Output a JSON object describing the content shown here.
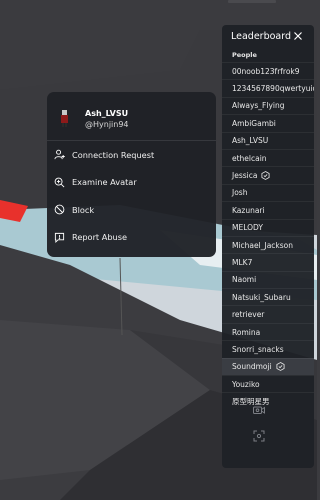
{
  "leaderboard": {
    "title": "Leaderboard",
    "section_label": "People",
    "players": [
      {
        "name": "00noob123frfrok9",
        "verified": false
      },
      {
        "name": "1234567890qwertyuiop",
        "verified": false
      },
      {
        "name": "Always_Flying",
        "verified": false
      },
      {
        "name": "AmbiGambi",
        "verified": false
      },
      {
        "name": "Ash_LVSU",
        "verified": false
      },
      {
        "name": "ethelcain",
        "verified": false
      },
      {
        "name": "Jessica",
        "verified": true
      },
      {
        "name": "Josh",
        "verified": false
      },
      {
        "name": "Kazunari",
        "verified": false
      },
      {
        "name": "MELODY",
        "verified": false
      },
      {
        "name": "Michael_Jackson",
        "verified": false
      },
      {
        "name": "MLK7",
        "verified": false
      },
      {
        "name": "Naomi",
        "verified": false
      },
      {
        "name": "Natsuki_Subaru",
        "verified": false
      },
      {
        "name": "retriever",
        "verified": false
      },
      {
        "name": "Romina",
        "verified": false
      },
      {
        "name": "Snorri_snacks",
        "verified": false
      },
      {
        "name": "Soundmoji",
        "verified": true,
        "highlighted": true
      },
      {
        "name": "Youziko",
        "verified": false
      },
      {
        "name": "原型明星男",
        "verified": false
      }
    ],
    "icons": [
      "close-icon",
      "verified-badge-icon",
      "voice-chat-icon",
      "fullscreen-icon"
    ]
  },
  "popup": {
    "display_name": "Ash_LVSU",
    "username": "@Hynjin94",
    "actions": [
      {
        "label": "Connection Request",
        "icon": "add-friend-icon"
      },
      {
        "label": "Examine Avatar",
        "icon": "examine-icon"
      },
      {
        "label": "Block",
        "icon": "block-icon"
      },
      {
        "label": "Report Abuse",
        "icon": "report-icon"
      }
    ]
  },
  "colors": {
    "panel_bg": "#1e2126",
    "text": "#ffffff",
    "accent_red": "#e8312c"
  }
}
